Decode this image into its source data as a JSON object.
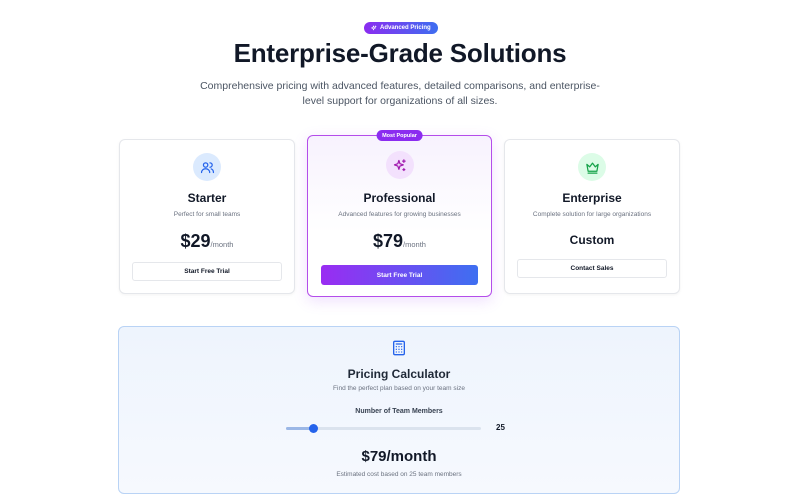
{
  "header": {
    "badge_label": "Advanced Pricing",
    "badge_icon": "sparkles-icon",
    "title": "Enterprise-Grade Solutions",
    "subtitle": "Comprehensive pricing with advanced features, detailed comparisons, and enterprise-level support for organizations of all sizes."
  },
  "plans": [
    {
      "name": "Starter",
      "icon": "users-icon",
      "description": "Perfect for small teams",
      "price": "$29",
      "period": "/month",
      "button_label": "Start Free Trial"
    },
    {
      "name": "Professional",
      "icon": "sparkles-icon",
      "badge": "Most Popular",
      "description": "Advanced features for growing businesses",
      "price": "$79",
      "period": "/month",
      "button_label": "Start Free Trial"
    },
    {
      "name": "Enterprise",
      "icon": "crown-icon",
      "description": "Complete solution for large organizations",
      "price": "Custom",
      "period": "",
      "button_label": "Contact Sales"
    }
  ],
  "calculator": {
    "icon": "calculator-icon",
    "title": "Pricing Calculator",
    "description": "Find the perfect plan based on your team size",
    "slider_label": "Number of Team Members",
    "team_members": "25",
    "slider_fraction": 0.14,
    "price": "$79/month",
    "note": "Estimated cost based on 25 team members"
  },
  "colors": {
    "accent_purple": "#8b2cf0",
    "accent_blue": "#3d6ef0",
    "slider_thumb": "#2563eb"
  }
}
